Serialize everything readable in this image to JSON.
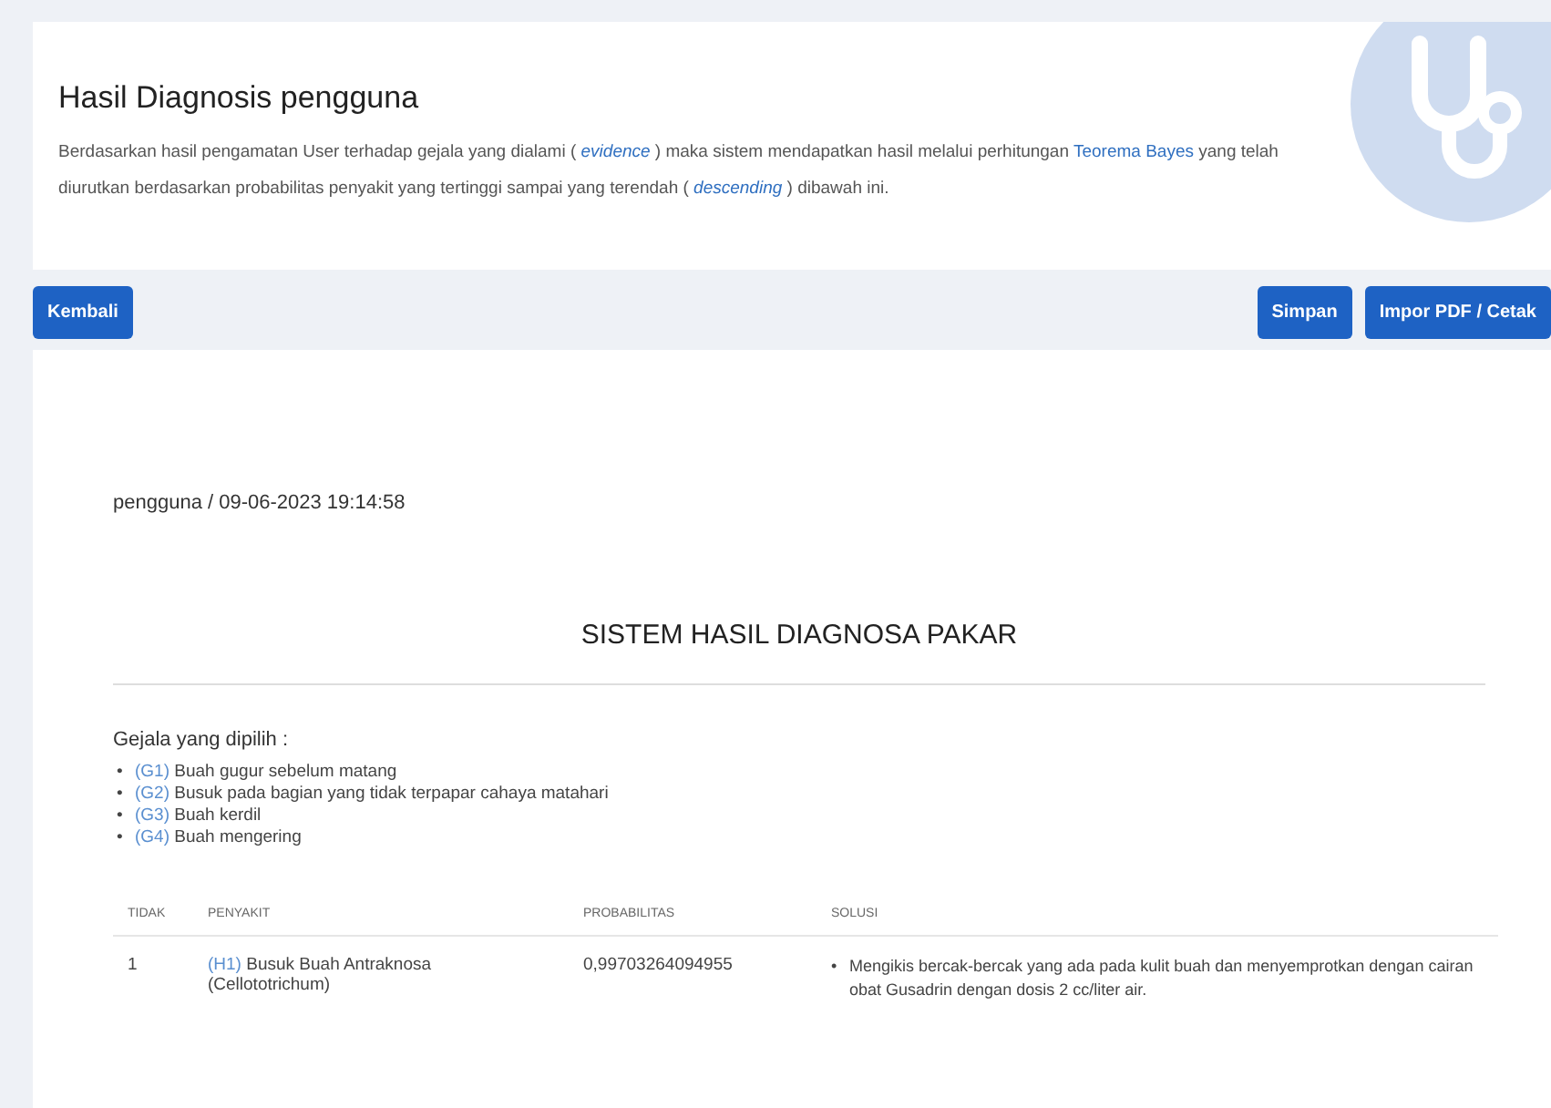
{
  "header": {
    "title": "Hasil Diagnosis pengguna",
    "description": [
      {
        "kind": "plain",
        "text": "Berdasarkan hasil pengamatan User terhadap gejala yang dialami ( "
      },
      {
        "kind": "em",
        "text": "evidence"
      },
      {
        "kind": "plain",
        "text": " ) maka sistem mendapatkan hasil melalui perhitungan "
      },
      {
        "kind": "link",
        "text": "Teorema Bayes"
      },
      {
        "kind": "plain",
        "text": " yang telah diurutkan berdasarkan probabilitas penyakit yang tertinggi sampai yang terendah ( "
      },
      {
        "kind": "em",
        "text": "descending"
      },
      {
        "kind": "plain",
        "text": " ) dibawah ini."
      }
    ]
  },
  "toolbar": {
    "back": "Kembali",
    "save": "Simpan",
    "print": "Impor PDF / Cetak"
  },
  "report": {
    "meta": "pengguna / 09-06-2023 19:14:58",
    "title": "SISTEM HASIL DIAGNOSA PAKAR",
    "symptoms_label": "Gejala yang dipilih :",
    "bullet": "•",
    "symptoms": [
      {
        "code": "(G1)",
        "text": "Buah gugur sebelum matang"
      },
      {
        "code": "(G2)",
        "text": "Busuk pada bagian yang tidak terpapar cahaya matahari"
      },
      {
        "code": "(G3)",
        "text": "Buah kerdil"
      },
      {
        "code": "(G4)",
        "text": "Buah mengering"
      }
    ],
    "table": {
      "columns": [
        "TIDAK",
        "PENYAKIT",
        "PROBABILITAS",
        "SOLUSI"
      ],
      "rows": [
        {
          "no": "1",
          "code": "(H1)",
          "disease": "Busuk Buah Antraknosa (Cellototrichum)",
          "probability": "0,99703264094955",
          "solutions": [
            "Mengikis bercak-bercak yang ada pada kulit buah dan menyemprotkan dengan cairan obat Gusadrin dengan dosis 2 cc/liter air."
          ]
        }
      ]
    }
  }
}
